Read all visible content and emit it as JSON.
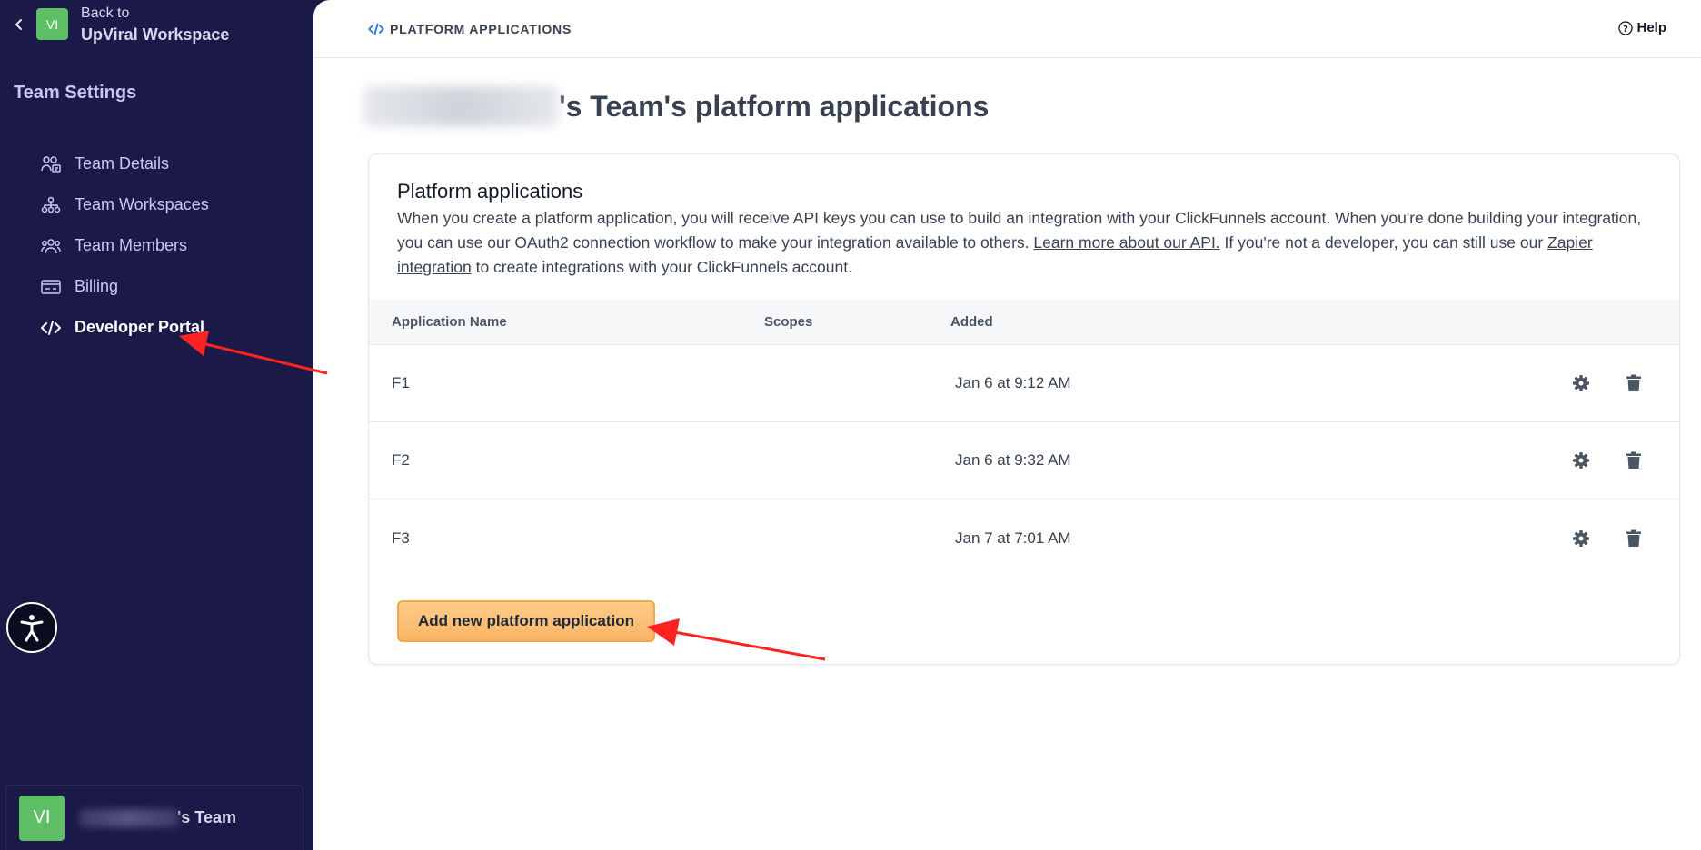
{
  "sidebar": {
    "back_small": "Back to",
    "back_workspace": "UpViral Workspace",
    "workspace_initials": "VI",
    "title": "Team Settings",
    "items": [
      {
        "label": "Team Details",
        "icon": "team-details-icon"
      },
      {
        "label": "Team Workspaces",
        "icon": "workspaces-icon"
      },
      {
        "label": "Team Members",
        "icon": "members-icon"
      },
      {
        "label": "Billing",
        "icon": "billing-icon"
      },
      {
        "label": "Developer Portal",
        "icon": "code-icon",
        "active": true
      }
    ],
    "team_initials": "VI",
    "team_suffix": "'s Team"
  },
  "header": {
    "breadcrumb": "PLATFORM APPLICATIONS",
    "help": "Help"
  },
  "page": {
    "title_suffix": "'s Team's platform applications"
  },
  "card": {
    "title": "Platform applications",
    "desc_1": "When you create a platform application, you will receive API keys you can use to build an integration with your ClickFunnels account. When you're done building your integration, you can use our OAuth2 connection workflow to make your integration available to others. ",
    "link_api": "Learn more about our API.",
    "desc_2": " If you're not a developer, you can still use our ",
    "link_zapier": "Zapier integration",
    "desc_3": " to create integrations with your ClickFunnels account.",
    "columns": [
      "Application Name",
      "Scopes",
      "Added"
    ],
    "rows": [
      {
        "name": "F1",
        "scopes": "",
        "added": "Jan 6 at 9:12 AM"
      },
      {
        "name": "F2",
        "scopes": "",
        "added": "Jan 6 at 9:32 AM"
      },
      {
        "name": "F3",
        "scopes": "",
        "added": "Jan 7 at 7:01 AM"
      }
    ],
    "add_button": "Add new platform application"
  },
  "colors": {
    "sidebar_bg": "#1b1947",
    "accent_green": "#5fbf66",
    "button_orange": "#fbb465",
    "annotation_red": "#ff2222"
  }
}
